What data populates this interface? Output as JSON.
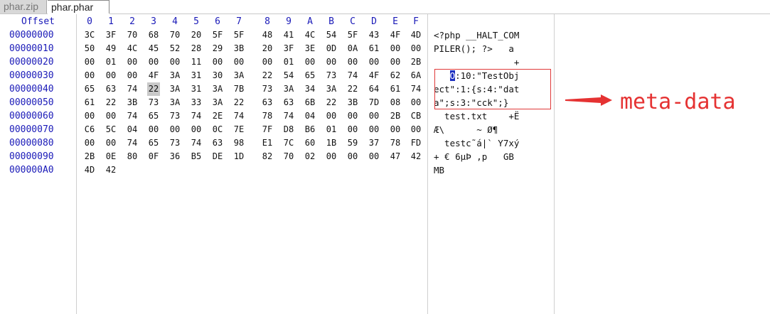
{
  "tabs": [
    {
      "label": "phar.zip",
      "active": false
    },
    {
      "label": "phar.phar",
      "active": true
    }
  ],
  "header": {
    "offset_label": "Offset",
    "hex_columns": [
      "0",
      "1",
      "2",
      "3",
      "4",
      "5",
      "6",
      "7",
      "8",
      "9",
      "A",
      "B",
      "C",
      "D",
      "E",
      "F"
    ]
  },
  "rows": [
    {
      "offset": "00000000",
      "hex": [
        "3C",
        "3F",
        "70",
        "68",
        "70",
        "20",
        "5F",
        "5F",
        "48",
        "41",
        "4C",
        "54",
        "5F",
        "43",
        "4F",
        "4D"
      ],
      "ascii": "<?php __HALT_COM"
    },
    {
      "offset": "00000010",
      "hex": [
        "50",
        "49",
        "4C",
        "45",
        "52",
        "28",
        "29",
        "3B",
        "20",
        "3F",
        "3E",
        "0D",
        "0A",
        "61",
        "00",
        "00"
      ],
      "ascii": "PILER(); ?>   a"
    },
    {
      "offset": "00000020",
      "hex": [
        "00",
        "01",
        "00",
        "00",
        "00",
        "11",
        "00",
        "00",
        "00",
        "01",
        "00",
        "00",
        "00",
        "00",
        "00",
        "2B"
      ],
      "ascii": "               +"
    },
    {
      "offset": "00000030",
      "hex": [
        "00",
        "00",
        "00",
        "4F",
        "3A",
        "31",
        "30",
        "3A",
        "22",
        "54",
        "65",
        "73",
        "74",
        "4F",
        "62",
        "6A"
      ],
      "ascii": "   O:10:\"TestObj"
    },
    {
      "offset": "00000040",
      "hex": [
        "65",
        "63",
        "74",
        "22",
        "3A",
        "31",
        "3A",
        "7B",
        "73",
        "3A",
        "34",
        "3A",
        "22",
        "64",
        "61",
        "74"
      ],
      "ascii": "ect\":1:{s:4:\"dat"
    },
    {
      "offset": "00000050",
      "hex": [
        "61",
        "22",
        "3B",
        "73",
        "3A",
        "33",
        "3A",
        "22",
        "63",
        "63",
        "6B",
        "22",
        "3B",
        "7D",
        "08",
        "00"
      ],
      "ascii": "a\";s:3:\"cck\";}"
    },
    {
      "offset": "00000060",
      "hex": [
        "00",
        "00",
        "74",
        "65",
        "73",
        "74",
        "2E",
        "74",
        "78",
        "74",
        "04",
        "00",
        "00",
        "00",
        "2B",
        "CB"
      ],
      "ascii": "  test.txt    +Ë"
    },
    {
      "offset": "00000070",
      "hex": [
        "C6",
        "5C",
        "04",
        "00",
        "00",
        "00",
        "0C",
        "7E",
        "7F",
        "D8",
        "B6",
        "01",
        "00",
        "00",
        "00",
        "00"
      ],
      "ascii": "Æ\\      ~ Ø¶"
    },
    {
      "offset": "00000080",
      "hex": [
        "00",
        "00",
        "74",
        "65",
        "73",
        "74",
        "63",
        "98",
        "E1",
        "7C",
        "60",
        "1B",
        "59",
        "37",
        "78",
        "FD"
      ],
      "ascii": "  testc˜á|` Y7xý"
    },
    {
      "offset": "00000090",
      "hex": [
        "2B",
        "0E",
        "80",
        "0F",
        "36",
        "B5",
        "DE",
        "1D",
        "82",
        "70",
        "02",
        "00",
        "00",
        "00",
        "47",
        "42"
      ],
      "ascii": "+ € 6µÞ ‚p   GB"
    },
    {
      "offset": "000000A0",
      "hex": [
        "4D",
        "42"
      ],
      "ascii": "MB"
    }
  ],
  "selected_hex": {
    "row": 4,
    "col": 3
  },
  "cursor_ascii": {
    "row": 3,
    "char_index": 3
  },
  "annotation": {
    "label": "meta-data",
    "color": "#e53232"
  },
  "colors": {
    "offset_blue": "#1a1ab8",
    "cursor_blue": "#1d2fbf",
    "box_red": "#e03a3a"
  }
}
